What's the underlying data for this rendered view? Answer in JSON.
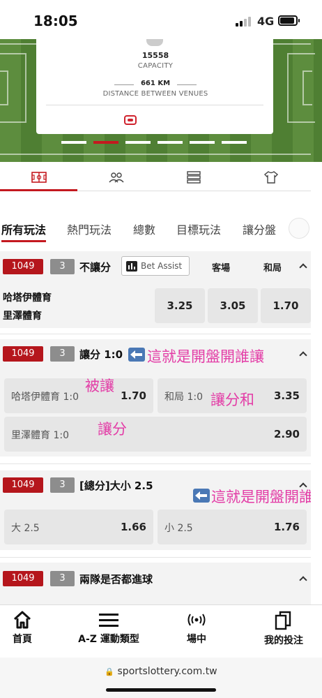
{
  "status_bar": {
    "time": "18:05",
    "network": "4G"
  },
  "venue": {
    "capacity_value": "15558",
    "capacity_label": "CAPACITY",
    "distance_value": "661 KM",
    "distance_label": "DISTANCE BETWEEN VENUES"
  },
  "info_tabs": [
    "pitch-icon",
    "players-icon",
    "standings-icon",
    "jersey-icon"
  ],
  "market_tabs": [
    "所有玩法",
    "熱門玩法",
    "總數",
    "目標玩法",
    "讓分盤"
  ],
  "markets": {
    "no_handicap": {
      "id": "1049",
      "count": "3",
      "title": "不讓分",
      "bet_assist": "Bet Assist",
      "col_away": "客場",
      "col_draw": "和局",
      "home_team": "哈塔伊體育",
      "away_team": "里澤體育",
      "odds": [
        "3.25",
        "3.05",
        "1.70"
      ]
    },
    "handicap": {
      "id": "1049",
      "count": "3",
      "title": "讓分 1:0",
      "annotation": "這就是開盤開誰讓",
      "options": [
        {
          "label": "哈塔伊體育 1:0",
          "value": "1.70"
        },
        {
          "label": "和局 1:0",
          "value": "3.35"
        },
        {
          "label": "里澤體育 1:0",
          "value": "2.90"
        }
      ],
      "annot_receive": "被讓",
      "annot_give": "讓分",
      "annot_draw": "讓分和"
    },
    "total": {
      "id": "1049",
      "count": "3",
      "title": "[總分]大小 2.5",
      "annotation": "這就是開盤開誰",
      "options": [
        {
          "label": "大 2.5",
          "value": "1.66"
        },
        {
          "label": "小 2.5",
          "value": "1.76"
        }
      ]
    },
    "btts": {
      "id": "1049",
      "count": "3",
      "title": "兩隊是否都進球"
    }
  },
  "bottom_nav": [
    {
      "label": "首頁",
      "icon": "home-icon"
    },
    {
      "label": "A-Z 運動類型",
      "icon": "menu-icon"
    },
    {
      "label": "場中",
      "icon": "live-icon"
    },
    {
      "label": "我的投注",
      "icon": "bets-icon"
    }
  ],
  "browser": {
    "url": "sportslottery.com.tw"
  }
}
